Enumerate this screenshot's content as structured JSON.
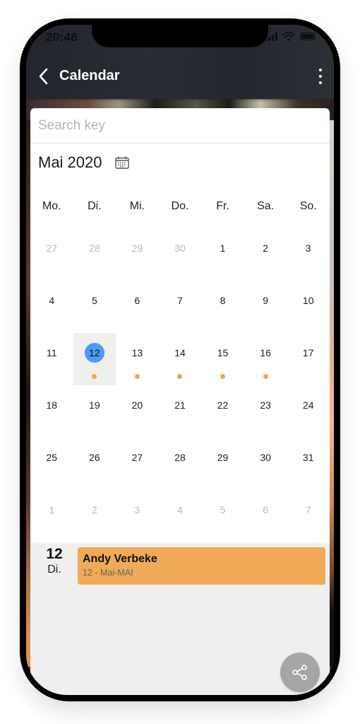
{
  "status_bar": {
    "time": "20:48",
    "signal_icon": "cellular-signal-icon",
    "wifi_icon": "wifi-icon",
    "battery_icon": "battery-icon"
  },
  "header": {
    "back_icon": "chevron-left-icon",
    "title": "Calendar",
    "more_icon": "more-vertical-icon"
  },
  "search": {
    "placeholder": "Search key",
    "value": ""
  },
  "calendar": {
    "month_label": "Mai 2020",
    "picker_icon": "calendar-icon",
    "weekdays": [
      "Mo.",
      "Di.",
      "Mi.",
      "Do.",
      "Fr.",
      "Sa.",
      "So."
    ],
    "weeks": [
      [
        {
          "d": "27",
          "muted": true
        },
        {
          "d": "28",
          "muted": true
        },
        {
          "d": "29",
          "muted": true
        },
        {
          "d": "30",
          "muted": true
        },
        {
          "d": "1"
        },
        {
          "d": "2"
        },
        {
          "d": "3"
        }
      ],
      [
        {
          "d": "4"
        },
        {
          "d": "5"
        },
        {
          "d": "6"
        },
        {
          "d": "7"
        },
        {
          "d": "8"
        },
        {
          "d": "9"
        },
        {
          "d": "10"
        }
      ],
      [
        {
          "d": "11"
        },
        {
          "d": "12",
          "selected": true,
          "today": true,
          "event": true
        },
        {
          "d": "13",
          "event": true
        },
        {
          "d": "14",
          "event": true
        },
        {
          "d": "15",
          "event": true
        },
        {
          "d": "16",
          "event": true
        },
        {
          "d": "17"
        }
      ],
      [
        {
          "d": "18"
        },
        {
          "d": "19"
        },
        {
          "d": "20"
        },
        {
          "d": "21"
        },
        {
          "d": "22"
        },
        {
          "d": "23"
        },
        {
          "d": "24"
        }
      ],
      [
        {
          "d": "25"
        },
        {
          "d": "26"
        },
        {
          "d": "27"
        },
        {
          "d": "28"
        },
        {
          "d": "29"
        },
        {
          "d": "30"
        },
        {
          "d": "31"
        }
      ],
      [
        {
          "d": "1",
          "muted": true
        },
        {
          "d": "2",
          "muted": true
        },
        {
          "d": "3",
          "muted": true
        },
        {
          "d": "4",
          "muted": true
        },
        {
          "d": "5",
          "muted": true
        },
        {
          "d": "6",
          "muted": true
        },
        {
          "d": "7",
          "muted": true
        }
      ]
    ]
  },
  "agenda": {
    "day_number": "12",
    "day_name": "Di.",
    "events": [
      {
        "title": "Andy Verbeke",
        "subtitle": "12 - Mai-MAI"
      }
    ]
  },
  "fab": {
    "icon": "share-icon"
  },
  "colors": {
    "accent_blue": "#4a9cf3",
    "event_orange": "#efab58",
    "event_dot": "#f0a54e",
    "header_bg": "#25272e",
    "fab_gray": "#a6a6a6"
  }
}
